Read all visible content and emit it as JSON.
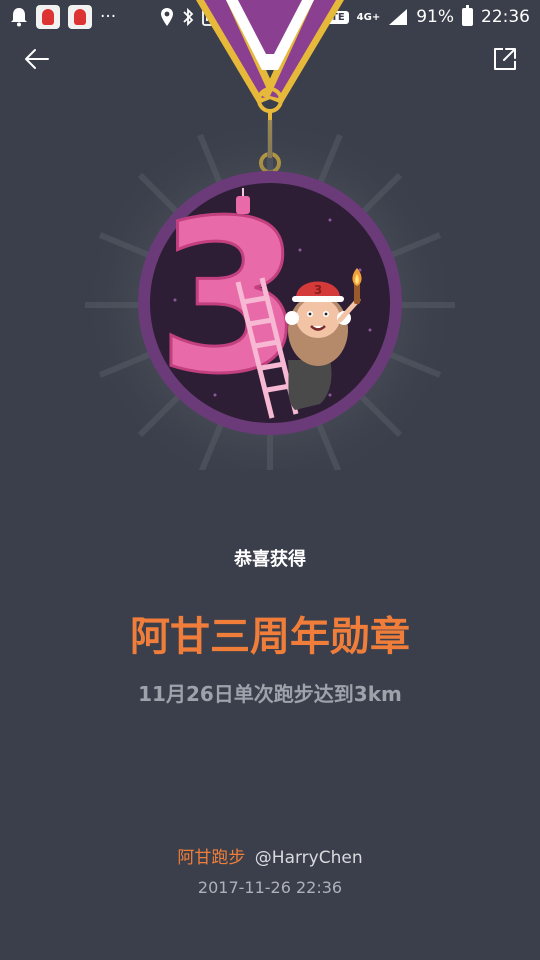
{
  "status_bar": {
    "dots": "···",
    "volte": "VoLTE",
    "network": "4G+",
    "battery": "91%",
    "time": "22:36",
    "icons": [
      "notification-bell-icon",
      "app-icon",
      "app-icon",
      "location-icon",
      "bluetooth-icon",
      "nfc-icon",
      "dnd-icon",
      "alarm-icon",
      "key-icon",
      "signal-icon",
      "battery-icon"
    ]
  },
  "nav": {
    "back_icon": "arrow-left-icon",
    "share_icon": "share-external-icon"
  },
  "medal": {
    "number": "3",
    "badge_number": "3",
    "colors": {
      "ribbon_purple": "#8b3f91",
      "ribbon_gold": "#e6b93a",
      "medal_bg": "#2e1e35",
      "medal_ring": "#6a3b78",
      "number_pink": "#e96aa8"
    }
  },
  "content": {
    "congrats": "恭喜获得",
    "title": "阿甘三周年勋章",
    "description": "11月26日单次跑步达到3km"
  },
  "footer": {
    "brand": "阿甘跑步",
    "user": "@HarryChen",
    "timestamp": "2017-11-26 22:36"
  }
}
